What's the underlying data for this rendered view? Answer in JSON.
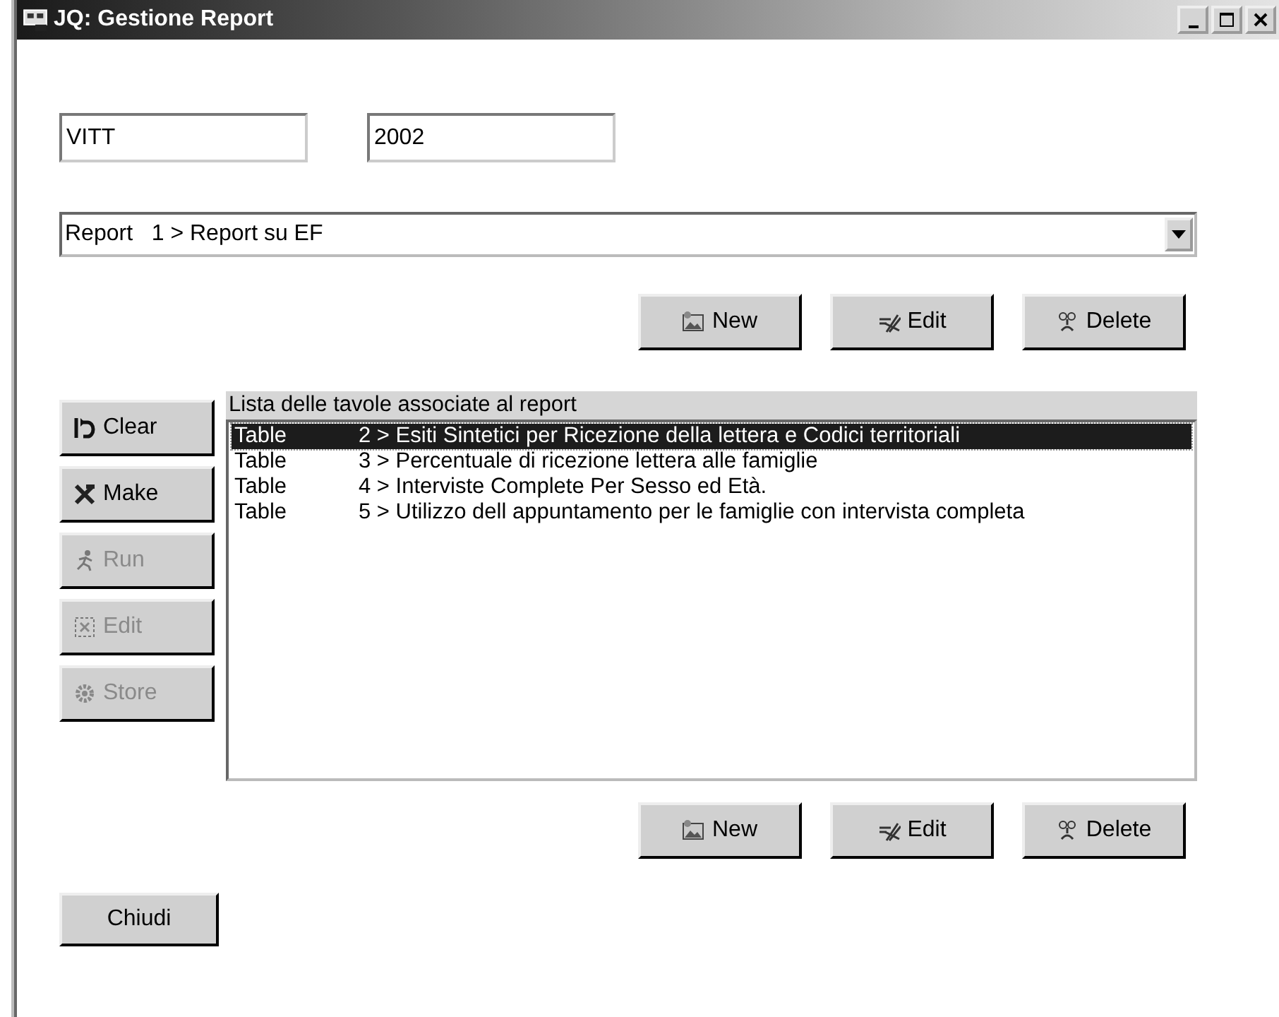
{
  "window": {
    "title": "JQ: Gestione Report"
  },
  "fields": [
    {
      "value": "VITT"
    },
    {
      "value": "2002"
    }
  ],
  "report_select": {
    "value": "Report   1 > Report su EF"
  },
  "report_buttons": [
    {
      "label": "New",
      "kind": "new"
    },
    {
      "label": "Edit",
      "kind": "edit"
    },
    {
      "label": "Delete",
      "kind": "delete"
    }
  ],
  "side_buttons": [
    {
      "label": "Clear",
      "kind": "clear",
      "disabled": false
    },
    {
      "label": "Make",
      "kind": "make",
      "disabled": false
    },
    {
      "label": "Run",
      "kind": "run",
      "disabled": true
    },
    {
      "label": "Edit",
      "kind": "select",
      "disabled": true
    },
    {
      "label": "Store",
      "kind": "store",
      "disabled": true
    }
  ],
  "table_list": {
    "title": "Lista delle tavole associate al report",
    "rows": [
      {
        "type": "Table",
        "name": "2 > Esiti Sintetici per Ricezione della lettera e Codici territoriali",
        "selected": true
      },
      {
        "type": "Table",
        "name": "3 > Percentuale di ricezione lettera alle famiglie",
        "selected": false
      },
      {
        "type": "Table",
        "name": "4 > Interviste Complete Per Sesso ed Età.",
        "selected": false
      },
      {
        "type": "Table",
        "name": "5 > Utilizzo dell appuntamento per le famiglie con intervista completa",
        "selected": false
      }
    ]
  },
  "table_buttons": [
    {
      "label": "New",
      "kind": "new"
    },
    {
      "label": "Edit",
      "kind": "edit"
    },
    {
      "label": "Delete",
      "kind": "delete"
    }
  ],
  "close_button": {
    "label": "Chiudi"
  }
}
